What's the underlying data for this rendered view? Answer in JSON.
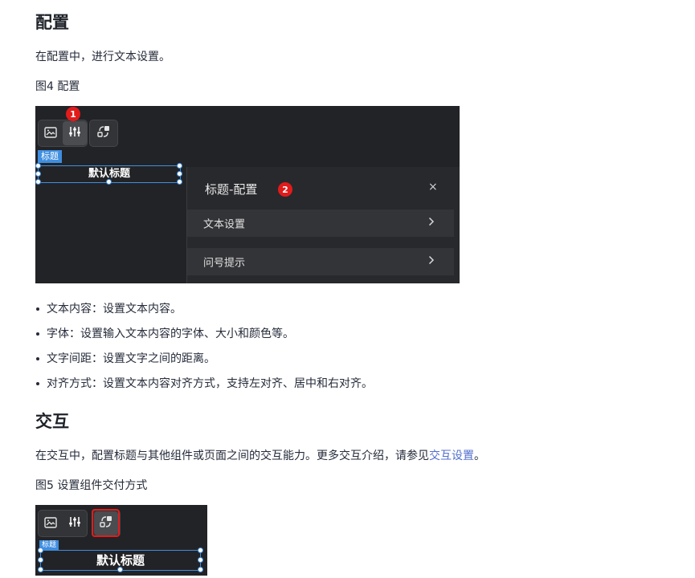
{
  "section_config": {
    "heading": "配置",
    "intro": "在配置中，进行文本设置。",
    "figure_caption": "图4 配置"
  },
  "figure4": {
    "step1_badge": "1",
    "step2_badge": "2",
    "tag_label": "标题",
    "selected_text": "默认标题",
    "panel_title": "标题-配置",
    "close_symbol": "×",
    "rows": [
      {
        "label": "文本设置"
      },
      {
        "label": "问号提示"
      }
    ]
  },
  "bullets": [
    "文本内容：设置文本内容。",
    "字体：设置输入文本内容的字体、大小和颜色等。",
    "文字间距：设置文字之间的距离。",
    "对齐方式：设置文本内容对齐方式，支持左对齐、居中和右对齐。"
  ],
  "section_interaction": {
    "heading": "交互",
    "intro_prefix": "在交互中，配置标题与其他组件或页面之间的交互能力。更多交互介绍，请参见",
    "intro_link": "交互设置",
    "intro_suffix": "。",
    "figure_caption": "图5 设置组件交付方式"
  },
  "figure5": {
    "tag_label": "标题",
    "selected_text": "默认标题"
  },
  "icons": [
    "image-icon",
    "sliders-icon",
    "interaction-icon",
    "chevron-right-icon",
    "close-icon"
  ]
}
